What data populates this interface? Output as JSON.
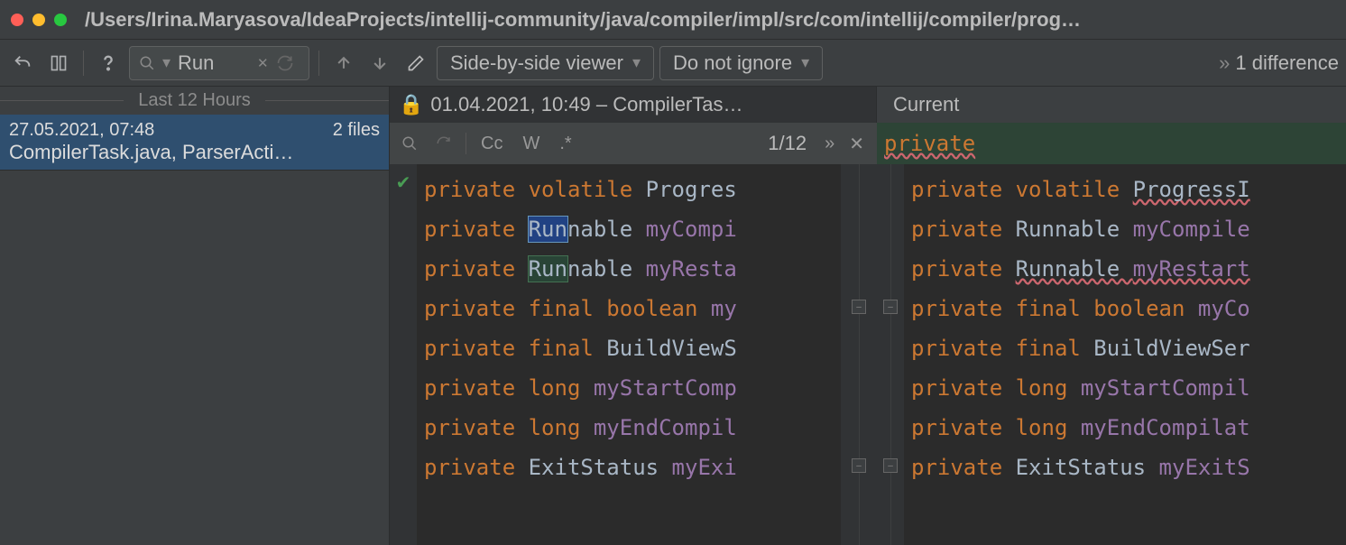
{
  "title_path": "/Users/Irina.Maryasova/IdeaProjects/intellij-community/java/compiler/impl/src/com/intellij/compiler/prog…",
  "toolbar": {
    "search_value": "Run",
    "viewer_mode": "Side-by-side viewer",
    "whitespace_mode": "Do not ignore",
    "diff_summary": "1 difference"
  },
  "sidebar": {
    "group_label": "Last 12 Hours",
    "item": {
      "timestamp": "27.05.2021, 07:48",
      "file_count": "2 files",
      "files_line": "CompilerTask.java, ParserActi…"
    }
  },
  "diff_header": {
    "left_label": "01.04.2021, 10:49 – CompilerTas…",
    "right_label": "Current"
  },
  "findbar": {
    "cc": "Cc",
    "w": "W",
    "regex": ".*",
    "count": "1/12"
  },
  "code": {
    "right_header": "private",
    "left": [
      {
        "pre": "private ",
        "mid": "volatile ",
        "post": "Progres"
      },
      {
        "pre": "private ",
        "hl": "Run",
        "hlclass": "hl-blue",
        "mid2": "nable ",
        "ident": "myCompi"
      },
      {
        "pre": "private ",
        "hl": "Run",
        "hlclass": "hl-green",
        "mid2": "nable ",
        "ident": "myResta"
      },
      {
        "pre": "private ",
        "mid": "final ",
        "kw2": "boolean ",
        "ident": "my"
      },
      {
        "pre": "private ",
        "mid": "final ",
        "type": "BuildViewS"
      },
      {
        "pre": "private ",
        "mid": "long ",
        "ident": "myStartComp"
      },
      {
        "pre": "private ",
        "mid": "long ",
        "ident": "myEndCompil"
      },
      {
        "pre": "private ",
        "type": "ExitStatus ",
        "ident": "myExi"
      }
    ],
    "right": [
      {
        "pre": "private ",
        "mid": "volatile ",
        "type": "ProgressI",
        "u": true
      },
      {
        "pre": "private ",
        "type": "Runnable ",
        "ident": "myCompile"
      },
      {
        "pre": "private ",
        "type": "Runnable ",
        "ident": "myRestart",
        "u": true
      },
      {
        "pre": "private ",
        "mid": "final ",
        "kw2": "boolean ",
        "ident": "myCo"
      },
      {
        "pre": "private ",
        "mid": "final ",
        "type": "BuildViewSer"
      },
      {
        "pre": "private ",
        "mid": "long ",
        "ident": "myStartCompil"
      },
      {
        "pre": "private ",
        "mid": "long ",
        "ident": "myEndCompilat"
      },
      {
        "pre": "private ",
        "type": "ExitStatus ",
        "ident": "myExitS"
      }
    ]
  }
}
